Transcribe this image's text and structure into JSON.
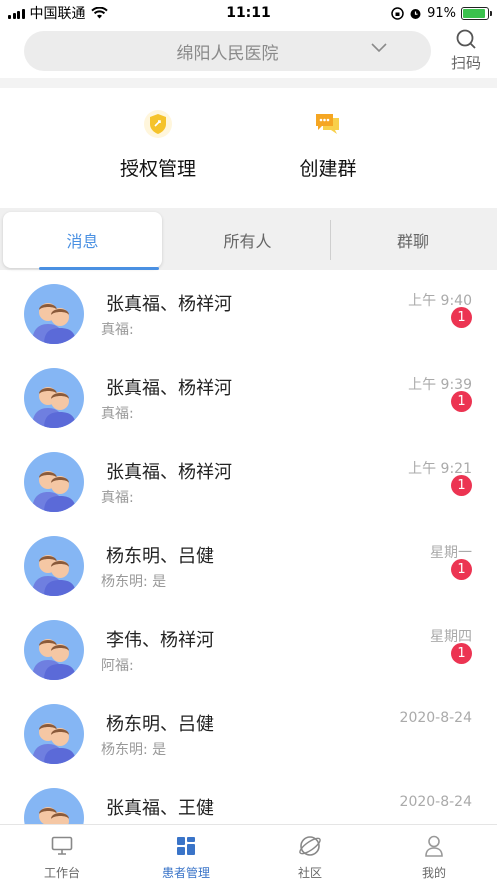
{
  "status_bar": {
    "carrier": "中国联通",
    "time": "11:11",
    "battery": "91%",
    "battery_level": 0.91
  },
  "header": {
    "hospital": "绵阳人民医院",
    "scan_label": "扫码"
  },
  "actions": [
    {
      "label": "授权管理",
      "icon": "shield-icon",
      "color": "#f5c32b"
    },
    {
      "label": "创建群",
      "icon": "chat-bubbles-icon",
      "color": "#f5a623"
    }
  ],
  "tabs": [
    {
      "label": "消息",
      "active": true
    },
    {
      "label": "所有人",
      "active": false
    },
    {
      "label": "群聊",
      "active": false
    }
  ],
  "conversations": [
    {
      "name": "张真福、杨祥河",
      "preview": "真福:",
      "time": "上午 9:40",
      "unread": "1"
    },
    {
      "name": "张真福、杨祥河",
      "preview": "真福:",
      "time": "上午 9:39",
      "unread": "1"
    },
    {
      "name": "张真福、杨祥河",
      "preview": "真福:",
      "time": "上午 9:21",
      "unread": "1"
    },
    {
      "name": "杨东明、吕健",
      "preview": "杨东明: 是",
      "time": "星期一",
      "unread": "1"
    },
    {
      "name": "李伟、杨祥河",
      "preview": "阿福:",
      "time": "星期四",
      "unread": "1"
    },
    {
      "name": "杨东明、吕健",
      "preview": "杨东明: 是",
      "time": "2020-8-24",
      "unread": ""
    },
    {
      "name": "张真福、王健",
      "preview": "",
      "time": "2020-8-24",
      "unread": ""
    }
  ],
  "bottom_nav": [
    {
      "label": "工作台",
      "icon": "monitor-icon",
      "active": false
    },
    {
      "label": "患者管理",
      "icon": "grid-icon",
      "active": true
    },
    {
      "label": "社区",
      "icon": "planet-icon",
      "active": false
    },
    {
      "label": "我的",
      "icon": "person-icon",
      "active": false
    }
  ],
  "colors": {
    "accent": "#4a90e2",
    "badge": "#ec3452",
    "avatar_bg": "#85b6f4",
    "nav_active": "#3a74c8"
  }
}
